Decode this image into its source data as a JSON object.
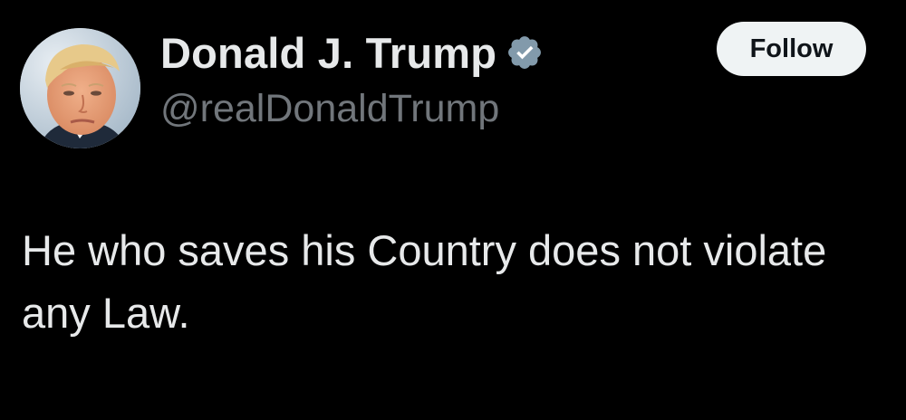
{
  "tweet": {
    "author": {
      "display_name": "Donald J. Trump",
      "handle": "@realDonaldTrump",
      "verified_icon": "verified-badge-icon",
      "avatar": "profile-photo"
    },
    "follow_label": "Follow",
    "text": "He who saves his Country does not violate any Law."
  },
  "colors": {
    "background": "#000000",
    "primary_text": "#e7e9ea",
    "secondary_text": "#71767b",
    "verified_badge": "#829aab",
    "follow_button_bg": "#eff3f4",
    "follow_button_text": "#0f1419"
  }
}
